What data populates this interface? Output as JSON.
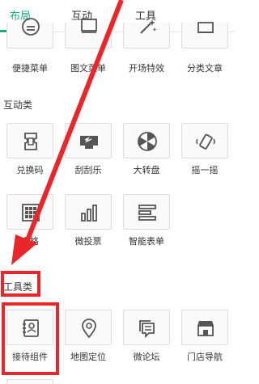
{
  "tabs": [
    {
      "label": "布局",
      "active": true
    },
    {
      "label": "互动",
      "active": false
    },
    {
      "label": "工具",
      "active": false
    }
  ],
  "layout_row": {
    "items": [
      {
        "label": "便捷菜单",
        "icon": "list-circle-icon"
      },
      {
        "label": "图文菜单",
        "icon": "image-menu-icon"
      },
      {
        "label": "开场特效",
        "icon": "magic-wand-icon"
      },
      {
        "label": "分类文章",
        "icon": "category-icon"
      }
    ]
  },
  "interactive": {
    "title": "互动类",
    "items": [
      {
        "label": "兑换码",
        "icon": "ticket-icon"
      },
      {
        "label": "刮刮乐",
        "icon": "scratch-card-icon"
      },
      {
        "label": "大转盘",
        "icon": "wheel-icon"
      },
      {
        "label": "摇一摇",
        "icon": "shake-phone-icon"
      },
      {
        "label": "宫格",
        "icon": "grid-icon"
      },
      {
        "label": "微投票",
        "icon": "bar-chart-icon"
      },
      {
        "label": "智能表单",
        "icon": "form-icon"
      }
    ]
  },
  "tools": {
    "title": "工具类",
    "items": [
      {
        "label": "接待组件",
        "icon": "contact-book-icon"
      },
      {
        "label": "地图定位",
        "icon": "map-pin-icon"
      },
      {
        "label": "微论坛",
        "icon": "forum-icon"
      },
      {
        "label": "门店导航",
        "icon": "store-icon"
      }
    ]
  },
  "colors": {
    "accent": "#1aad7a",
    "highlight": "#e8262b",
    "icon": "#555555"
  }
}
